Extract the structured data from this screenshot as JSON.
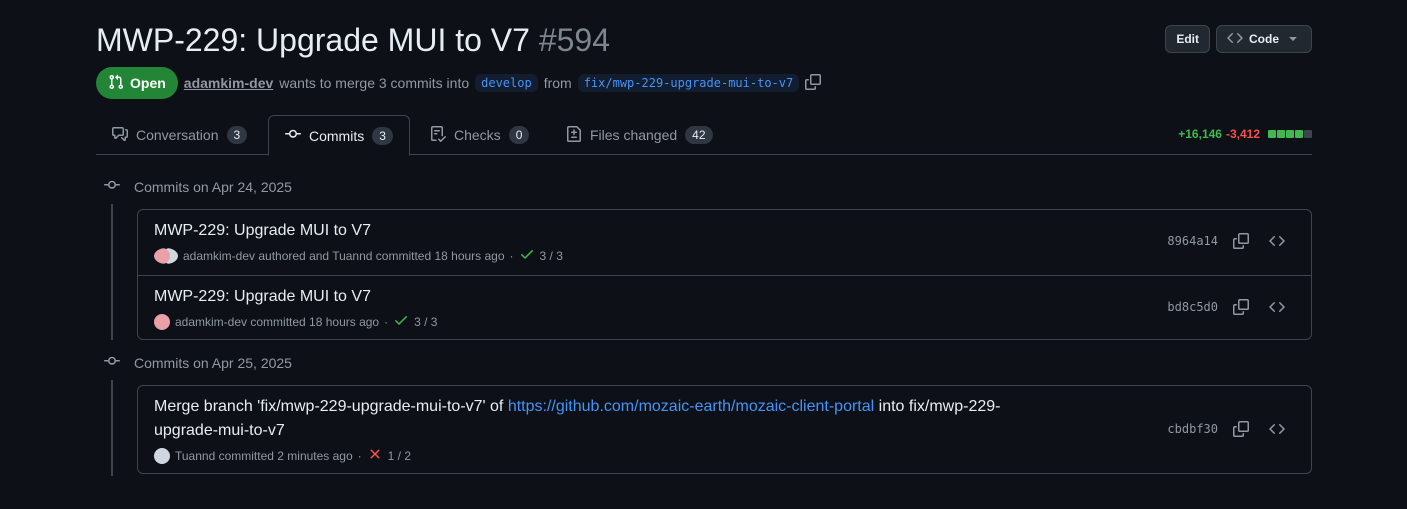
{
  "pr": {
    "title": "MWP-229: Upgrade MUI to V7",
    "number": "#594",
    "state": "Open",
    "author": "adamkim-dev",
    "summary_pre": "wants to merge 3 commits into",
    "base_branch": "develop",
    "from_word": "from",
    "head_branch": "fix/mwp-229-upgrade-mui-to-v7"
  },
  "header_buttons": {
    "edit": "Edit",
    "code": "Code"
  },
  "tabs": [
    {
      "label": "Conversation",
      "count": "3",
      "icon": "comment-discussion-icon"
    },
    {
      "label": "Commits",
      "count": "3",
      "icon": "git-commit-icon"
    },
    {
      "label": "Checks",
      "count": "0",
      "icon": "checklist-icon"
    },
    {
      "label": "Files changed",
      "count": "42",
      "icon": "file-diff-icon"
    }
  ],
  "diffstat": {
    "additions": "+16,146",
    "deletions": "-3,412",
    "green_blocks": 4,
    "gray_blocks": 1
  },
  "colors": {
    "green": "#3fb950",
    "red": "#f85149",
    "link": "#4493f8",
    "open_badge": "#238636"
  },
  "groups": [
    {
      "heading": "Commits on Apr 24, 2025",
      "commits": [
        {
          "message": "MWP-229: Upgrade MUI to V7",
          "meta": "adamkim-dev authored and Tuannd committed 18 hours ago",
          "sep": "·",
          "status": "3 / 3",
          "status_kind": "success",
          "sha": "8964a14"
        },
        {
          "message": "MWP-229: Upgrade MUI to V7",
          "meta": "adamkim-dev committed 18 hours ago",
          "sep": "·",
          "status": "3 / 3",
          "status_kind": "success",
          "sha": "bd8c5d0"
        }
      ]
    },
    {
      "heading": "Commits on Apr 25, 2025",
      "commits": [
        {
          "message_pre": "Merge branch 'fix/mwp-229-upgrade-mui-to-v7' of",
          "message_link": "https://github.com/mozaic-earth/mozaic-client-portal",
          "message_post_1": "into fix/mwp-229-",
          "message_post_2": "upgrade-mui-to-v7",
          "meta": "Tuannd committed 2 minutes ago",
          "sep": "·",
          "status": "1 / 2",
          "status_kind": "failure",
          "sha": "cbdbf30"
        }
      ]
    }
  ]
}
